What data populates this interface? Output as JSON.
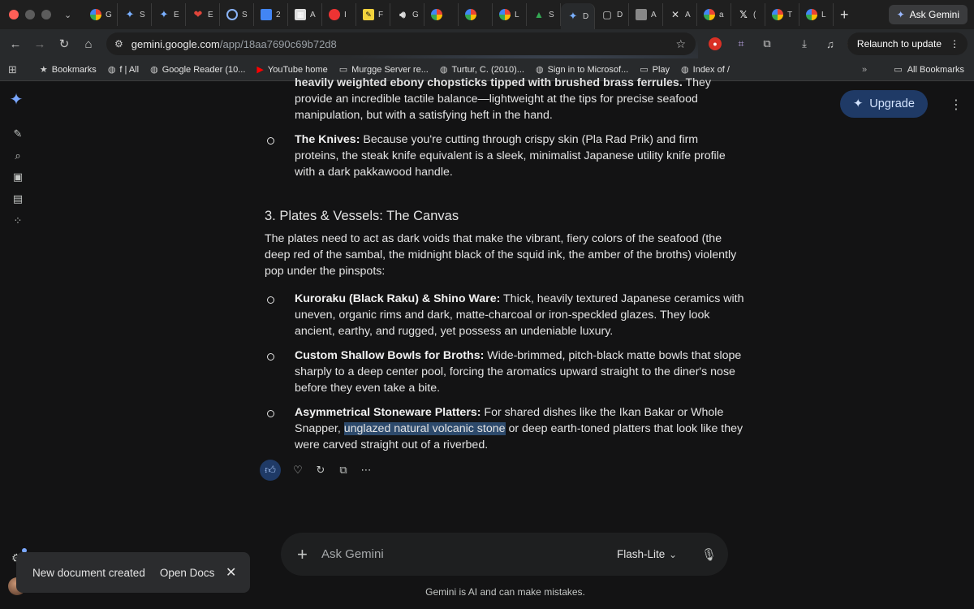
{
  "browser": {
    "tabs": [
      {
        "icon": "google-icon",
        "label": "G"
      },
      {
        "icon": "gemini-icon",
        "label": "S"
      },
      {
        "icon": "gemini-icon",
        "label": "E"
      },
      {
        "icon": "heart-icon",
        "label": "E"
      },
      {
        "icon": "circle-icon",
        "label": "S"
      },
      {
        "icon": "docs-icon",
        "label": "2"
      },
      {
        "icon": "grid-icon",
        "label": "A"
      },
      {
        "icon": "red-icon",
        "label": "I"
      },
      {
        "icon": "yellow-icon",
        "label": "F"
      },
      {
        "icon": "audio-icon",
        "label": "G"
      },
      {
        "icon": "google-icon",
        "label": ""
      },
      {
        "icon": "google-icon",
        "label": ""
      },
      {
        "icon": "google-icon",
        "label": "L"
      },
      {
        "icon": "drive-icon",
        "label": "S"
      },
      {
        "icon": "gemini-icon",
        "label": "D"
      },
      {
        "icon": "monitor-icon",
        "label": "D"
      },
      {
        "icon": "gray-icon",
        "label": "A"
      },
      {
        "icon": "close-icon",
        "label": "A"
      },
      {
        "icon": "google-icon",
        "label": "a"
      },
      {
        "icon": "x-icon",
        "label": "("
      },
      {
        "icon": "google-icon",
        "label": "T"
      },
      {
        "icon": "google-icon",
        "label": "L"
      }
    ],
    "ask_gemini_label": "Ask Gemini",
    "url_host": "gemini.google.com",
    "url_path": "/app/18aa7690c69b72d8",
    "relaunch_label": "Relaunch to update",
    "bookmarks": [
      {
        "icon": "star-icon",
        "label": "Bookmarks"
      },
      {
        "icon": "globe-icon",
        "label": "f | All"
      },
      {
        "icon": "globe-icon",
        "label": "Google Reader (10..."
      },
      {
        "icon": "youtube-icon",
        "label": "YouTube home"
      },
      {
        "icon": "folder-icon",
        "label": "Murgge Server re..."
      },
      {
        "icon": "globe-icon",
        "label": "Turtur, C. (2010)..."
      },
      {
        "icon": "globe-icon",
        "label": "Sign in to Microsof..."
      },
      {
        "icon": "folder-icon",
        "label": "Play"
      },
      {
        "icon": "globe-icon",
        "label": "Index of /"
      }
    ],
    "bookmarks_more": "»",
    "all_bookmarks_label": "All Bookmarks"
  },
  "content": {
    "top_partial": {
      "bold": "heavily weighted ebony chopsticks tipped with brushed brass ferrules.",
      "text": " They provide an incredible tactile balance—lightweight at the tips for precise seafood manipulation, but with a satisfying heft in the hand."
    },
    "knives": {
      "bold": "The Knives:",
      "text": " Because you're cutting through crispy skin (Pla Rad Prik) and firm proteins, the steak knife equivalent is a sleek, minimalist Japanese utility knife profile with a dark pakkawood handle."
    },
    "section_heading": "3. Plates & Vessels: The Canvas",
    "section_intro": "The plates need to act as dark voids that make the vibrant, fiery colors of the seafood (the deep red of the sambal, the midnight black of the squid ink, the amber of the broths) violently pop under the pinspots:",
    "items": [
      {
        "bold": "Kuroraku (Black Raku) & Shino Ware:",
        "text": " Thick, heavily textured Japanese ceramics with uneven, organic rims and dark, matte-charcoal or iron-speckled glazes. They look ancient, earthy, and rugged, yet possess an undeniable luxury."
      },
      {
        "bold": "Custom Shallow Bowls for Broths:",
        "text": " Wide-brimmed, pitch-black matte bowls that slope sharply to a deep center pool, forcing the aromatics upward straight to the diner's nose before they even take a bite."
      },
      {
        "bold": "Asymmetrical Stoneware Platters:",
        "text_before": " For shared dishes like the Ikan Bakar or Whole Snapper, ",
        "highlight": "unglazed natural volcanic stone",
        "text_after": " or deep earth-toned platters that look like they were carved straight out of a riverbed."
      }
    ]
  },
  "upgrade_label": "Upgrade",
  "input": {
    "placeholder": "Ask Gemini",
    "model": "Flash-Lite"
  },
  "disclaimer": "Gemini is AI and can make mistakes.",
  "toast": {
    "message": "New document created",
    "action": "Open Docs"
  },
  "colors": {
    "background": "#131314",
    "accent": "#1f3a66",
    "highlight": "#2d4a6c"
  }
}
